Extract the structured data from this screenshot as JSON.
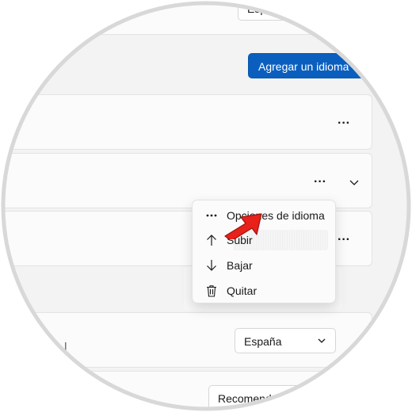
{
  "language_row_top": {
    "select_value_partial": "Esp"
  },
  "add_language_button": {
    "label": "Agregar un idioma"
  },
  "more_options_label": "···",
  "context_menu": {
    "items": [
      {
        "label": "Opciones de idioma",
        "icon": "more-dots-icon"
      },
      {
        "label": "Subir",
        "icon": "arrow-up-icon"
      },
      {
        "label": "Bajar",
        "icon": "arrow-down-icon"
      },
      {
        "label": "Quitar",
        "icon": "trash-icon"
      }
    ]
  },
  "region_select": {
    "value": "España"
  },
  "format_select": {
    "value": "Recomend"
  },
  "colors": {
    "accent": "#0a5fbe",
    "arrow_annotation": "#e8211b",
    "frame": "#d8d8d8"
  }
}
